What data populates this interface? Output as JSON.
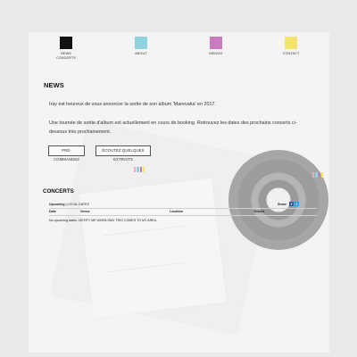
{
  "nav": {
    "items": [
      {
        "label": "NEWS\nCONCERTS",
        "color": "#111111"
      },
      {
        "label": "ABOUT",
        "color": "#8fd3e0"
      },
      {
        "label": "MEDIAS",
        "color": "#c97bbf"
      },
      {
        "label": "CONTACT",
        "color": "#f3e36a"
      }
    ]
  },
  "news": {
    "title": "NEWS",
    "p1": "Iray est heureux de vous annoncer la sortie de son album 'Marevaka' en 2017.",
    "p2": "Une tournée de sortie d'album est actuellement en cours de booking. Retrouvez les dates des prochains concerts ci-dessous très prochainement.",
    "order_button": "PRÉ-COMMANDEZ",
    "listen_button": "ÉCOUTEZ QUELQUES EXTRAITS"
  },
  "concerts": {
    "title": "CONCERTS",
    "upcoming_label": "Upcoming",
    "local_dates": "| LOCAL DATES",
    "share_label": "Share",
    "facebook": "f",
    "twitter": "t",
    "columns": [
      "Date",
      "Venue",
      "Location",
      "Tickets"
    ],
    "no_dates": "No upcoming dates.",
    "notify": "NOTIFY ME WHEN IRAY TRIO COMES TO MY AREA."
  },
  "palette": {
    "swatches": [
      "#f3a6c8",
      "#8fd3e0",
      "#c97bbf",
      "#f3e36a"
    ]
  }
}
